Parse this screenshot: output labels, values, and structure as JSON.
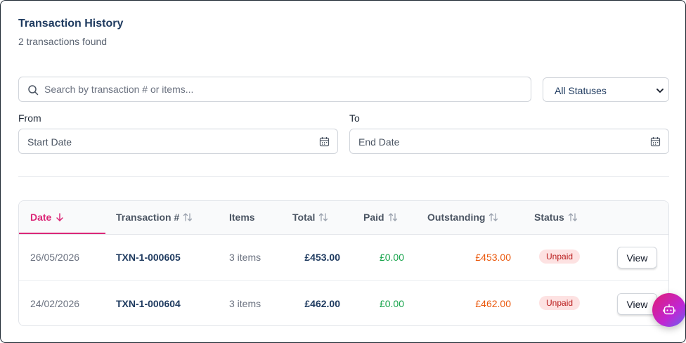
{
  "header": {
    "title": "Transaction History",
    "subtitle": "2 transactions found"
  },
  "filters": {
    "search_placeholder": "Search by transaction # or items...",
    "status_selected": "All Statuses",
    "from_label": "From",
    "from_placeholder": "Start Date",
    "to_label": "To",
    "to_placeholder": "End Date"
  },
  "table": {
    "columns": {
      "date": "Date",
      "txn": "Transaction #",
      "items": "Items",
      "total": "Total",
      "paid": "Paid",
      "outstanding": "Outstanding",
      "status": "Status"
    },
    "sort": {
      "column": "date",
      "direction": "desc"
    },
    "rows": [
      {
        "date": "26/05/2026",
        "txn": "TXN-1-000605",
        "items": "3 items",
        "total": "£453.00",
        "paid": "£0.00",
        "outstanding": "£453.00",
        "status": "Unpaid",
        "action": "View"
      },
      {
        "date": "24/02/2026",
        "txn": "TXN-1-000604",
        "items": "3 items",
        "total": "£462.00",
        "paid": "£0.00",
        "outstanding": "£462.00",
        "status": "Unpaid",
        "action": "View"
      }
    ]
  },
  "icons": {
    "search": "search-icon",
    "calendar": "calendar-icon",
    "sort": "sort-icon",
    "sort_active": "arrow-down-icon",
    "chat_bot": "robot-icon"
  },
  "colors": {
    "accent": "#db2777",
    "title": "#1e3a5f",
    "paid": "#16a34a",
    "outstanding": "#ea580c",
    "badge_bg": "#fde2e2",
    "badge_text": "#b91c1c"
  }
}
